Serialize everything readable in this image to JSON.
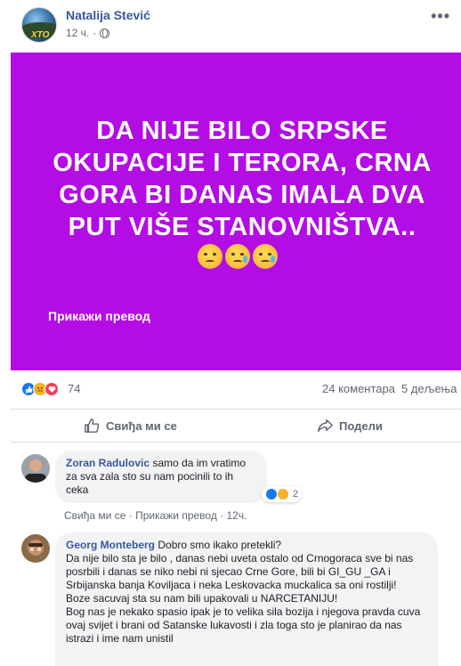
{
  "post": {
    "author": "Natalija Stević",
    "time": "12 ч.",
    "more": "•••",
    "text": "DA NIJE BILO SRPSKE OKUPACIJE I TERORA, CRNA GORA BI DANAS IMALA DVA PUT VIŠE STANOVNIŠTVA..",
    "avatar_badge": "XTO",
    "translate": "Прикажи превод",
    "background_color": "#b30ce5",
    "emojis": [
      "sleepy-face",
      "crying-face",
      "crying-face"
    ]
  },
  "stats": {
    "reactions": "74",
    "comments": "24 коментара",
    "shares": "5 дељења"
  },
  "actions": {
    "like": "Свиђа ми се",
    "share": "Подели"
  },
  "comments": [
    {
      "author": "Zoran Radulovic",
      "text": "samo da im vratimo za sva zala sto su nam pocinili to ih ceka",
      "reaction_count": "2",
      "footer": {
        "like": "Свиђа ми се",
        "sep": " · ",
        "translate": "Прикажи превод",
        "time": "12ч."
      }
    },
    {
      "author": "Georg Monteberg",
      "text": "Dobro smo ikako pretekli?\nDa nije bilo sta je bilo , danas nebi uveta ostalo od Crnogoraca sve bi nas posrbili i danas se niko nebi ni sjecao Crne Gore, bili bi GI_GU _GA i Srbijanska banja Koviljaca i neka Leskovacka muckalica sa oni rostilji!\nBoze sacuvaj sta su nam bili upakovali u NARCETANIJU!\nBog nas je nekako spasio ipak je to velika sila bozija i njegova pravda cuva ovaj svijet i brani od Satanske lukavosti i zla toga sto je planirao da nas istrazi i ime nam unistil"
    }
  ]
}
